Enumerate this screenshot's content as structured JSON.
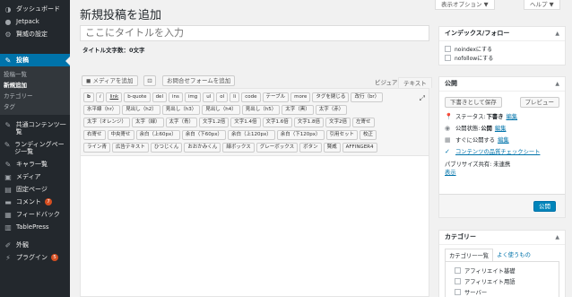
{
  "sidebar": {
    "items": [
      {
        "label": "ダッシュボード",
        "icon": "dashboard-icon",
        "glyph": "◑"
      },
      {
        "label": "Jetpack",
        "icon": "jetpack-icon",
        "glyph": "●"
      },
      {
        "label": "賢威の設定",
        "icon": "gear-icon",
        "glyph": "⚙"
      },
      {
        "label": "投稿",
        "icon": "pin-icon",
        "glyph": "✎"
      }
    ],
    "submenu": [
      "投稿一覧",
      "新規追加",
      "カテゴリー",
      "タグ"
    ],
    "items2": [
      {
        "label": "共通コンテンツ一覧",
        "icon": "pin-icon",
        "glyph": "✎"
      },
      {
        "label": "ランディングページ一覧",
        "icon": "pin-icon",
        "glyph": "✎"
      },
      {
        "label": "キャラ一覧",
        "icon": "pin-icon",
        "glyph": "✎"
      },
      {
        "label": "メディア",
        "icon": "media-icon",
        "glyph": "▣"
      },
      {
        "label": "固定ページ",
        "icon": "page-icon",
        "glyph": "▤"
      },
      {
        "label": "コメント",
        "icon": "comment-icon",
        "glyph": "▬",
        "badge": "7"
      },
      {
        "label": "フィードバック",
        "icon": "feedback-icon",
        "glyph": "▦"
      },
      {
        "label": "TablePress",
        "icon": "table-icon",
        "glyph": "▥"
      },
      {
        "label": "外観",
        "icon": "brush-icon",
        "glyph": "✐"
      },
      {
        "label": "プラグイン",
        "icon": "plugin-icon",
        "glyph": "⚡",
        "badge": "5"
      }
    ]
  },
  "topbar": {
    "screen_options": "表示オプション ▼",
    "help": "ヘルプ ▼"
  },
  "page_title": "新規投稿を追加",
  "title_placeholder": "ここにタイトルを入力",
  "title_count": "タイトル文字数：0文字",
  "media": {
    "add_media": "メディアを追加",
    "add_form": "お問合せフォームを追加",
    "visual_tab": "ビジュアル",
    "text_tab": "テキスト",
    "camera_icon": "add-media-icon",
    "form_icon": "contact-form-icon"
  },
  "quicktags": [
    [
      "b",
      "i",
      "link",
      "b-quote",
      "del",
      "ins",
      "img",
      "ul",
      "ol",
      "li",
      "code",
      "テーブル",
      "more",
      "タグを閉じる",
      "改行（br）"
    ],
    [
      "水平線（hr）",
      "見出し（h2）",
      "見出し（h3）",
      "見出し（h4）",
      "見出し（h5）",
      "太字（黒）",
      "太字（赤）"
    ],
    [
      "太字（オレンジ）",
      "太字（緑）",
      "太字（青）",
      "文字1.2倍",
      "文字1.4倍",
      "文字1.6倍",
      "文字1.8倍",
      "文字2倍",
      "左寄せ"
    ],
    [
      "右寄せ",
      "中央寄せ",
      "余白（上60px）",
      "余白（下60px）",
      "余白（上120px）",
      "余白（下120px）",
      "引用セット",
      "校正"
    ],
    [
      "ライン青",
      "広告テキスト",
      "ひつじくん",
      "おおかみくん",
      "緑ボックス",
      "グレーボックス",
      "ボタン",
      "賢威",
      "AFFINGER4"
    ]
  ],
  "index_box": {
    "title": "インデックス/フォロー",
    "options": [
      "noindexにする",
      "nofollowにする"
    ]
  },
  "publish": {
    "title": "公開",
    "save_draft": "下書きとして保存",
    "preview": "プレビュー",
    "status_label": "ステータス:",
    "status_value": "下書き",
    "visibility_label": "公開状態:",
    "visibility_value": "公開",
    "schedule_label": "すぐに公開する",
    "edit": "編集",
    "quality_check": "コンテンツの品質チェックシート",
    "share_label": "パブリサイズ共有: 未連携",
    "share_show": "表示",
    "publish_btn": "公開"
  },
  "category": {
    "title": "カテゴリー",
    "tab_all": "カテゴリー一覧",
    "tab_popular": "よく使うもの",
    "items": [
      "アフィリエイト基礎",
      "アフィリエイト用語",
      "サーバー"
    ]
  },
  "colors": {
    "sidebar_bg": "#23282d",
    "active": "#0073aa",
    "primary_btn": "#0085ba",
    "badge": "#d54e21"
  }
}
